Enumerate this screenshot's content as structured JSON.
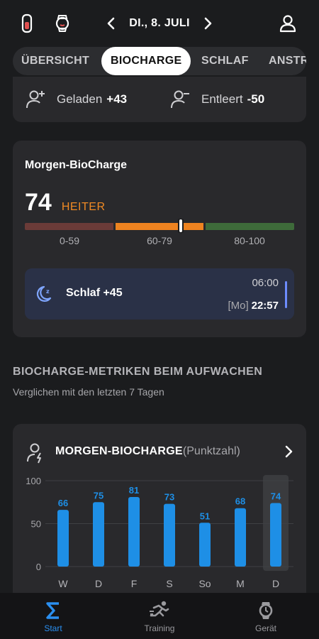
{
  "header": {
    "date_label": "DI., 8. JULI",
    "icons": [
      "phone-band-icon",
      "watch-icon",
      "chevron-left-icon",
      "chevron-right-icon",
      "profile-icon"
    ]
  },
  "tabs": [
    {
      "label": "ÜBERSICHT",
      "active": false
    },
    {
      "label": "BIOCHARGE",
      "active": true
    },
    {
      "label": "SCHLAF",
      "active": false
    },
    {
      "label": "ANSTR",
      "active": false
    }
  ],
  "summary": {
    "charged_label": "Geladen",
    "charged_value": "+43",
    "drained_label": "Entleert",
    "drained_value": "-50"
  },
  "morning": {
    "title": "Morgen-BioCharge",
    "score": "74",
    "status": "HEITER",
    "score_value": 74,
    "ranges": [
      "0-59",
      "60-79",
      "80-100"
    ],
    "colors": {
      "low": "#6b3b38",
      "mid": "#ee8320",
      "high": "#3e6b3a",
      "accent": "#f08a24"
    },
    "sleep_label": "Schlaf +45",
    "sleep_end": "06:00",
    "sleep_start_day": "[Mo]",
    "sleep_start_time": "22:57"
  },
  "section": {
    "title": "BIOCHARGE-METRIKEN BEIM AUFWACHEN",
    "subtitle": "Verglichen mit den letzten 7 Tagen"
  },
  "chart_card": {
    "title_main": "MORGEN-BIOCHARGE",
    "title_unit": "(Punktzahl)"
  },
  "chart_data": {
    "type": "bar",
    "categories": [
      "W",
      "D",
      "F",
      "S",
      "So",
      "M",
      "D"
    ],
    "values": [
      66,
      75,
      81,
      73,
      51,
      68,
      74
    ],
    "ylim": [
      0,
      100
    ],
    "yticks": [
      0,
      50,
      100
    ],
    "highlight_index": 6,
    "bar_color": "#1e8fe6",
    "xlabel": "",
    "ylabel": "",
    "grid": true
  },
  "nav": [
    {
      "label": "Start",
      "active": true,
      "icon": "sigma-icon"
    },
    {
      "label": "Training",
      "active": false,
      "icon": "running-icon"
    },
    {
      "label": "Gerät",
      "active": false,
      "icon": "watch-icon"
    }
  ]
}
